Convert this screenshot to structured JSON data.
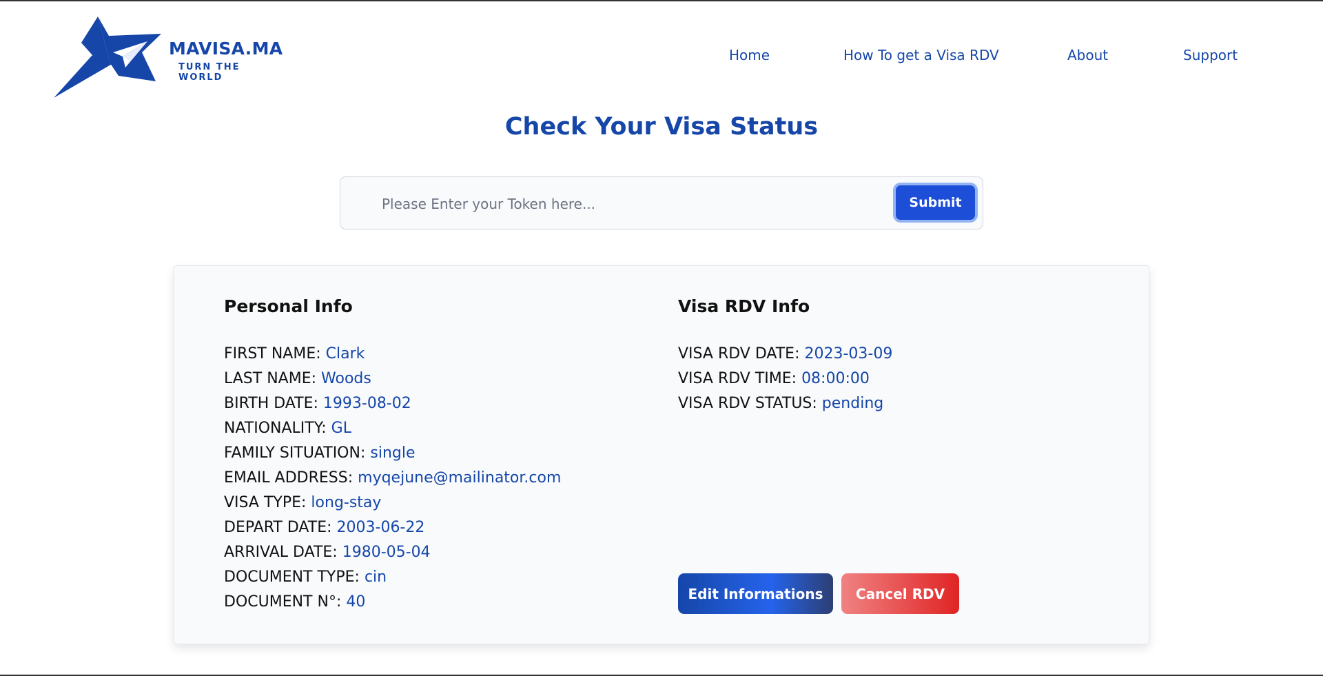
{
  "header": {
    "logo": {
      "brand": "MAVISA.MA",
      "tagline": "TURN THE WORLD",
      "icon": "star-paper-plane-icon"
    },
    "nav": [
      {
        "label": "Home"
      },
      {
        "label": "How To get a Visa RDV"
      },
      {
        "label": "About"
      },
      {
        "label": "Support"
      }
    ]
  },
  "page": {
    "title": "Check Your Visa Status"
  },
  "search": {
    "value": "",
    "placeholder": "Please Enter your Token here...",
    "submit_label": "Submit"
  },
  "personal_info": {
    "title": "Personal Info",
    "fields": [
      {
        "label": "FIRST NAME:",
        "value": "Clark"
      },
      {
        "label": "LAST NAME:",
        "value": "Woods"
      },
      {
        "label": "BIRTH DATE:",
        "value": "1993-08-02"
      },
      {
        "label": "NATIONALITY:",
        "value": "GL"
      },
      {
        "label": "FAMILY SITUATION:",
        "value": "single"
      },
      {
        "label": "EMAIL ADDRESS:",
        "value": "myqejune@mailinator.com"
      },
      {
        "label": "VISA TYPE:",
        "value": "long-stay"
      },
      {
        "label": "DEPART DATE:",
        "value": "2003-06-22"
      },
      {
        "label": "ARRIVAL DATE:",
        "value": "1980-05-04"
      },
      {
        "label": "DOCUMENT TYPE:",
        "value": "cin"
      },
      {
        "label": "DOCUMENT N°:",
        "value": "40"
      }
    ]
  },
  "visa_rdv_info": {
    "title": "Visa RDV Info",
    "fields": [
      {
        "label": "VISA RDV DATE:",
        "value": "2023-03-09"
      },
      {
        "label": "VISA RDV TIME:",
        "value": "08:00:00"
      },
      {
        "label": "VISA RDV STATUS:",
        "value": "pending"
      }
    ]
  },
  "actions": {
    "edit_label": "Edit Informations",
    "cancel_label": "Cancel RDV"
  },
  "colors": {
    "brand": "#1546a8",
    "primary_button": "#1d4ed8",
    "danger": "#e02424",
    "card_background": "#f8fafc"
  }
}
